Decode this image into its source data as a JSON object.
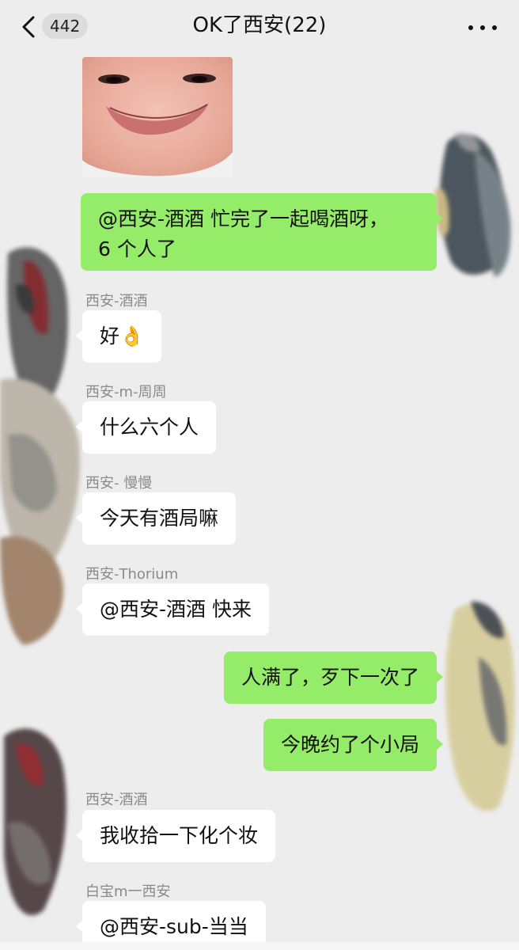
{
  "header": {
    "unread_count": "442",
    "title": "OK了西安(22)"
  },
  "icons": {
    "back": "chevron-left-icon",
    "more": "more-dots-icon",
    "sticker": "face-sticker-image"
  },
  "colors": {
    "background": "#ededed",
    "outgoing_bubble": "#95ec69",
    "incoming_bubble": "#ffffff"
  },
  "messages": [
    {
      "direction": "out",
      "text_line1": "@西安-酒酒  忙完了一起喝酒呀，",
      "text_line2": "6 个人了"
    },
    {
      "direction": "in",
      "sender": "西安-酒酒",
      "text": "好👌"
    },
    {
      "direction": "in",
      "sender": "西安-m-周周",
      "text": "什么六个人"
    },
    {
      "direction": "in",
      "sender": "西安- 慢慢",
      "text": "今天有酒局嘛"
    },
    {
      "direction": "in",
      "sender": "西安-Thorium",
      "text": "@西安-酒酒  快来"
    },
    {
      "direction": "out",
      "text": "人满了，歹下一次了"
    },
    {
      "direction": "out",
      "text": "今晚约了个小局"
    },
    {
      "direction": "in",
      "sender": "西安-酒酒",
      "text": "我收拾一下化个妆"
    },
    {
      "direction": "in",
      "sender": "白宝m一西安",
      "text": "@西安-sub-当当"
    }
  ]
}
